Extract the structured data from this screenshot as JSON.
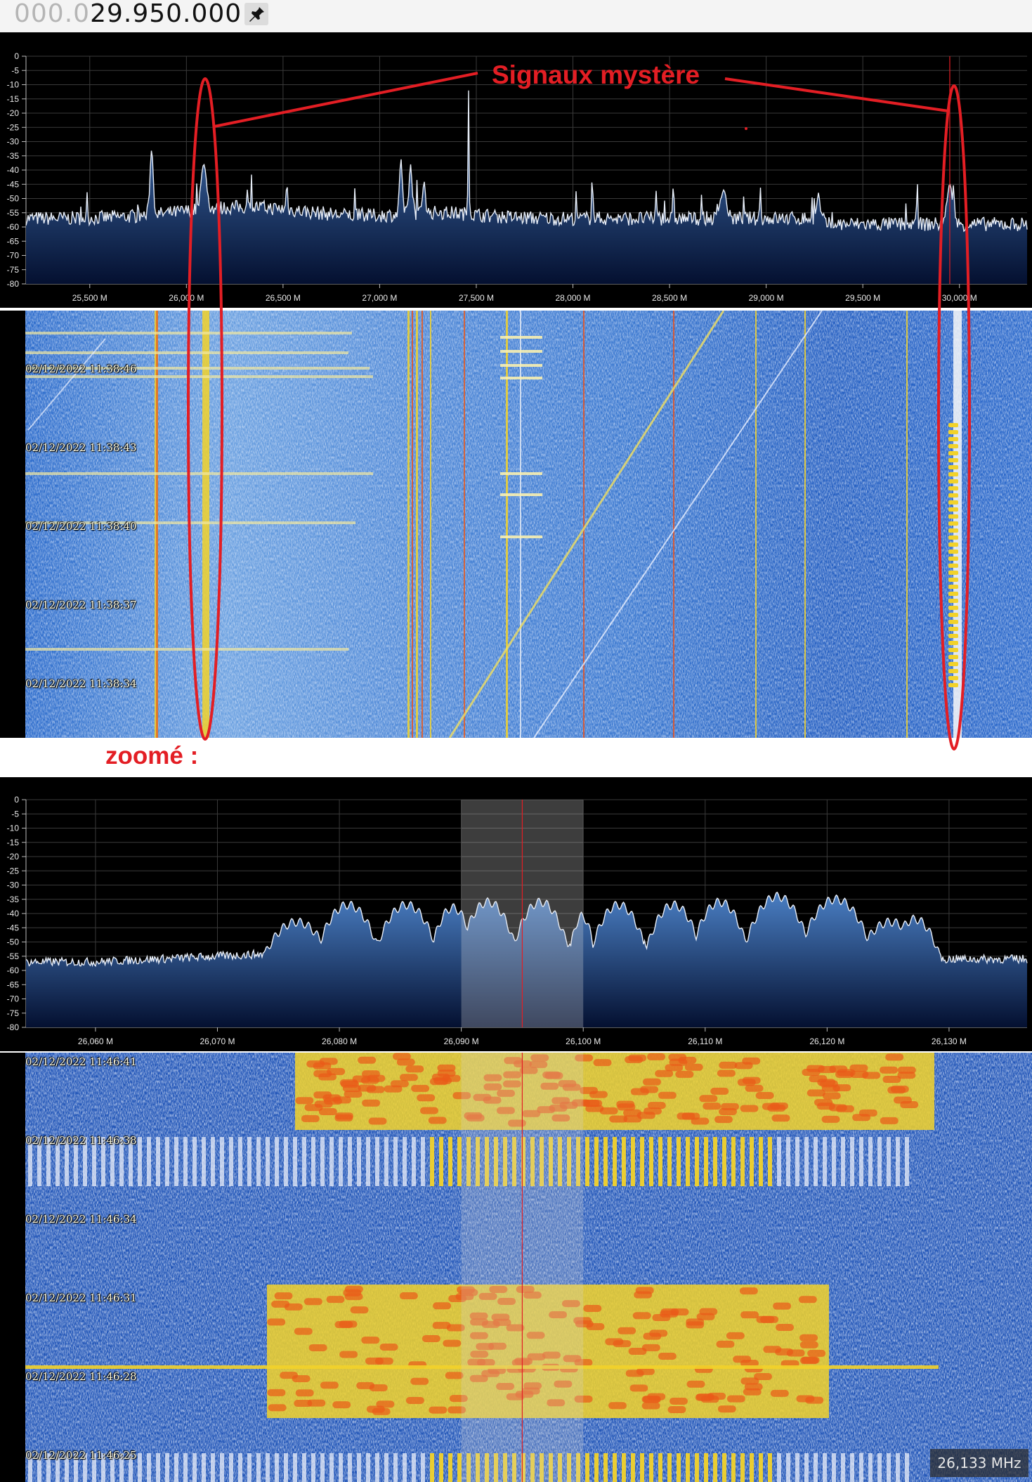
{
  "frequency": {
    "dim": "000.0",
    "main": "29.950.000",
    "pin_icon": "pin-icon"
  },
  "spectrum_wide": {
    "y_ticks": [
      "0",
      "-5",
      "-10",
      "-15",
      "-20",
      "-25",
      "-30",
      "-35",
      "-40",
      "-45",
      "-50",
      "-55",
      "-60",
      "-65",
      "-70",
      "-75",
      "-80"
    ],
    "x_ticks": [
      "25,500 M",
      "26,000 M",
      "26,500 M",
      "27,000 M",
      "27,500 M",
      "28,000 M",
      "28,500 M",
      "29,000 M",
      "29,500 M",
      "30,000 M"
    ],
    "x_range": [
      25.17,
      30.35
    ],
    "y_range": [
      -80,
      0
    ]
  },
  "waterfall_wide": {
    "timestamps": [
      "02/12/2022 11:38:46",
      "02/12/2022 11:38:43",
      "02/12/2022 11:38:40",
      "02/12/2022 11:38:37",
      "02/12/2022 11:38:34"
    ]
  },
  "annotations": {
    "title": "Signaux mystère",
    "zoom_label": "zoomé :"
  },
  "spectrum_zoom": {
    "y_ticks": [
      "0",
      "-5",
      "-10",
      "-15",
      "-20",
      "-25",
      "-30",
      "-35",
      "-40",
      "-45",
      "-50",
      "-55",
      "-60",
      "-65",
      "-70",
      "-75",
      "-80"
    ],
    "x_ticks": [
      "26,060 M",
      "26,070 M",
      "26,080 M",
      "26,090 M",
      "26,100 M",
      "26,110 M",
      "26,120 M",
      "26,130 M"
    ],
    "x_range": [
      26.0543,
      26.1364
    ],
    "y_range": [
      -80,
      0
    ],
    "filter_band": [
      26.09,
      26.1
    ],
    "center": 26.095
  },
  "waterfall_zoom": {
    "timestamps": [
      "02/12/2022 11:46:41",
      "02/12/2022 11:46:38",
      "02/12/2022 11:46:34",
      "02/12/2022 11:46:31",
      "02/12/2022 11:46:28",
      "02/12/2022 11:46:25"
    ]
  },
  "cursor_readout": "26,133 MHz",
  "colors": {
    "annotation": "#e31e24",
    "trace": "#e8eef8",
    "fill_top": "#4a7fc4",
    "fill_bottom": "#041030",
    "waterfall_base": "#2a67c8",
    "signal_hot": "#f2d22a"
  }
}
